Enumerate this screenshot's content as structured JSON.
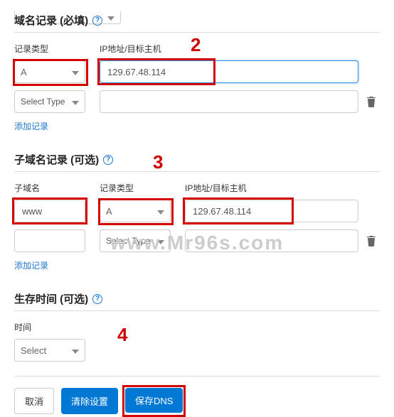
{
  "top_select_caret": "▾",
  "sections": {
    "domain_records": {
      "title": "域名记录 (必填)"
    },
    "subdomain_records": {
      "title": "子域名记录 (可选)"
    },
    "ttl": {
      "title": "生存时间 (可选)"
    }
  },
  "help_glyph": "?",
  "labels": {
    "record_type": "记录类型",
    "ip_target": "IP地址/目标主机",
    "subdomain": "子域名",
    "time": "时间"
  },
  "domain_rows": [
    {
      "type": "A",
      "ip": "129.67.48.114"
    },
    {
      "type": "Select Type",
      "ip": ""
    }
  ],
  "subdomain_rows": [
    {
      "sub": "www",
      "type": "A",
      "ip": "129.67.48.114"
    },
    {
      "sub": "",
      "type": "Select Type",
      "ip": ""
    }
  ],
  "add_record_label": "添加记录",
  "ttl_select": "Select",
  "buttons": {
    "cancel": "取消",
    "clear": "清除设置",
    "save": "保存DNS"
  },
  "annotations": {
    "a2": "2",
    "a3": "3",
    "a4": "4"
  },
  "watermark": "www.Mr96s.com"
}
